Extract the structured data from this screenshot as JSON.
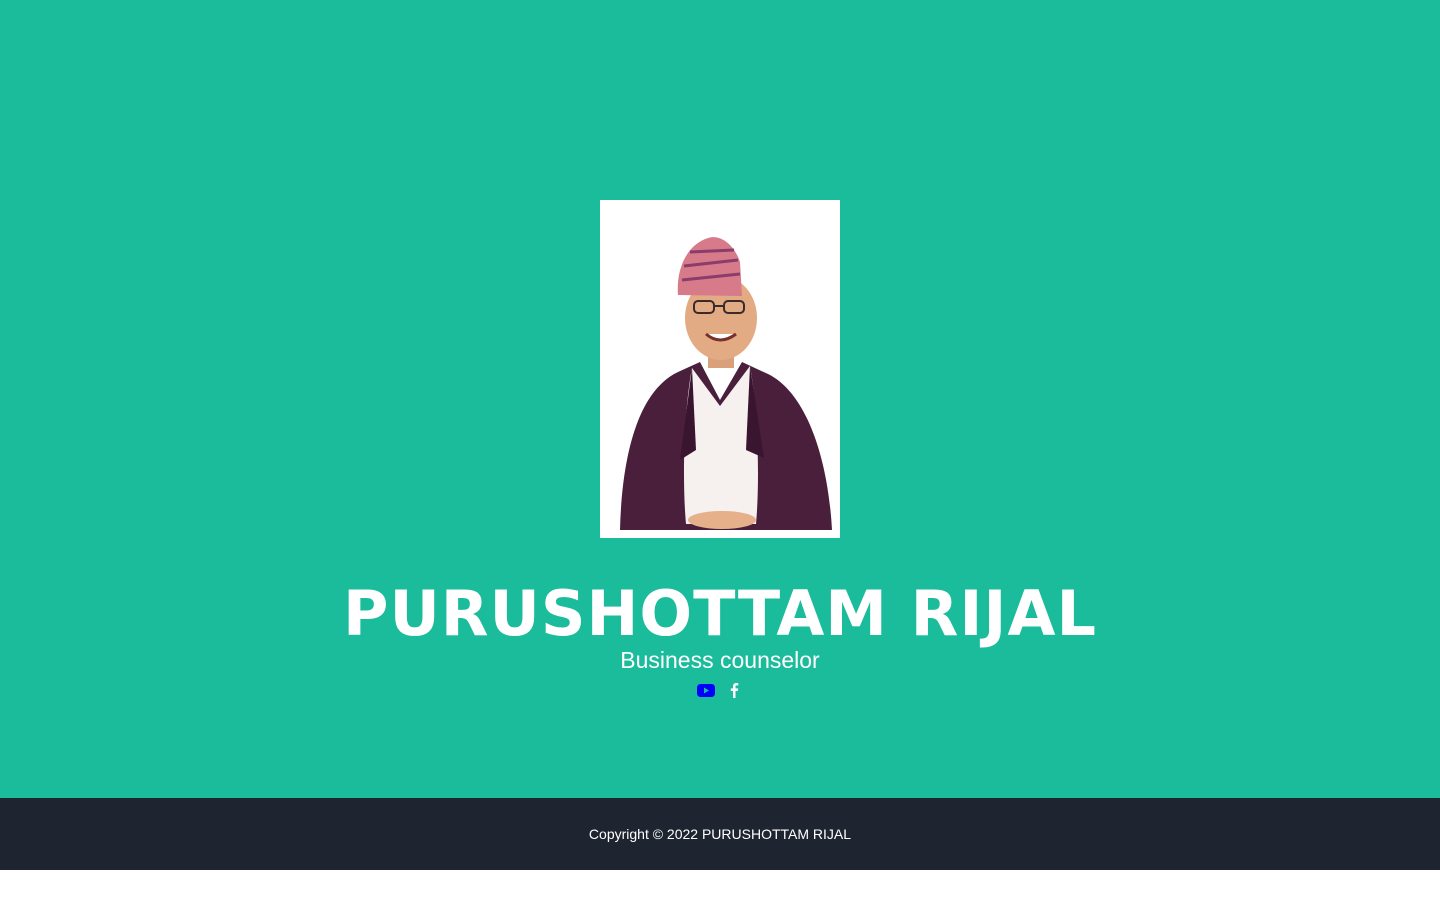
{
  "hero": {
    "name": "PURUSHOTTAM RIJAL",
    "subtitle": "Business counselor",
    "background_color": "#1abc9c",
    "portrait_alt": "Portrait of Purushottam Rijal"
  },
  "social": {
    "icons": [
      "youtube-icon",
      "facebook-icon"
    ],
    "youtube_color": "#0000ff"
  },
  "footer": {
    "copyright": "Copyright © 2022 PURUSHOTTAM RIJAL",
    "background_color": "#1e2530"
  }
}
